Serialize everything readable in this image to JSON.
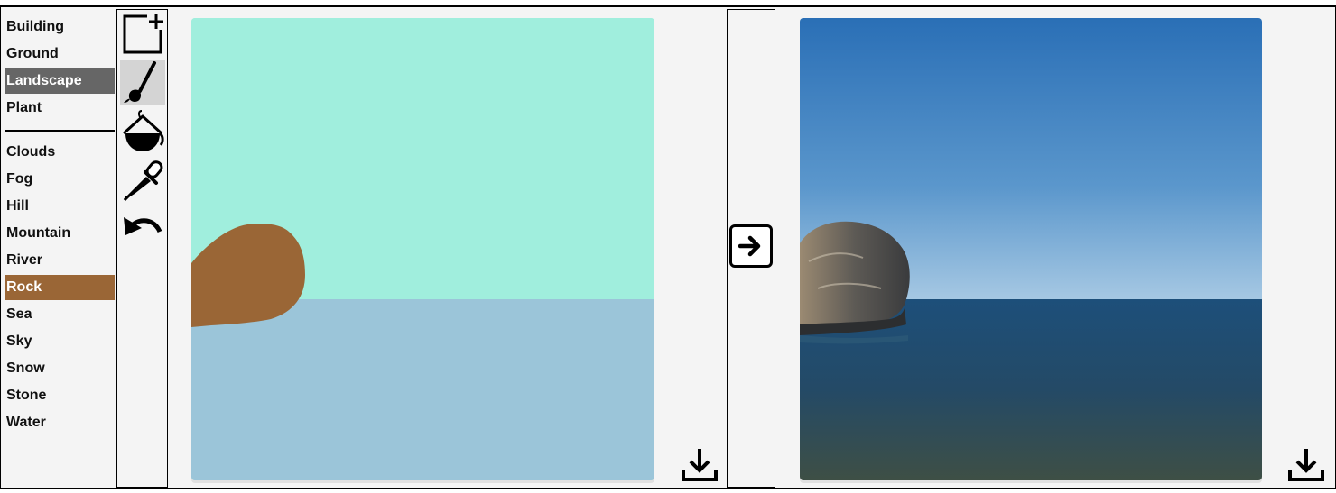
{
  "labels": {
    "top": [
      "Building",
      "Ground",
      "Landscape",
      "Plant"
    ],
    "bottom": [
      "Clouds",
      "Fog",
      "Hill",
      "Mountain",
      "River",
      "Rock",
      "Sea",
      "Sky",
      "Snow",
      "Stone",
      "Water"
    ],
    "selected_category": "Landscape",
    "selected_label": "Rock"
  },
  "tools": [
    {
      "name": "new-canvas-icon",
      "active": false
    },
    {
      "name": "brush-icon",
      "active": true
    },
    {
      "name": "paint-bucket-icon",
      "active": false
    },
    {
      "name": "eyedropper-icon",
      "active": false
    },
    {
      "name": "undo-icon",
      "active": false
    }
  ],
  "colors": {
    "sky": "#a0eedd",
    "sea": "#9bc5d9",
    "rock": "#9a6636",
    "selected_gray": "#666666"
  },
  "icons": {
    "convert": "arrow-right-icon",
    "download": "download-icon"
  }
}
